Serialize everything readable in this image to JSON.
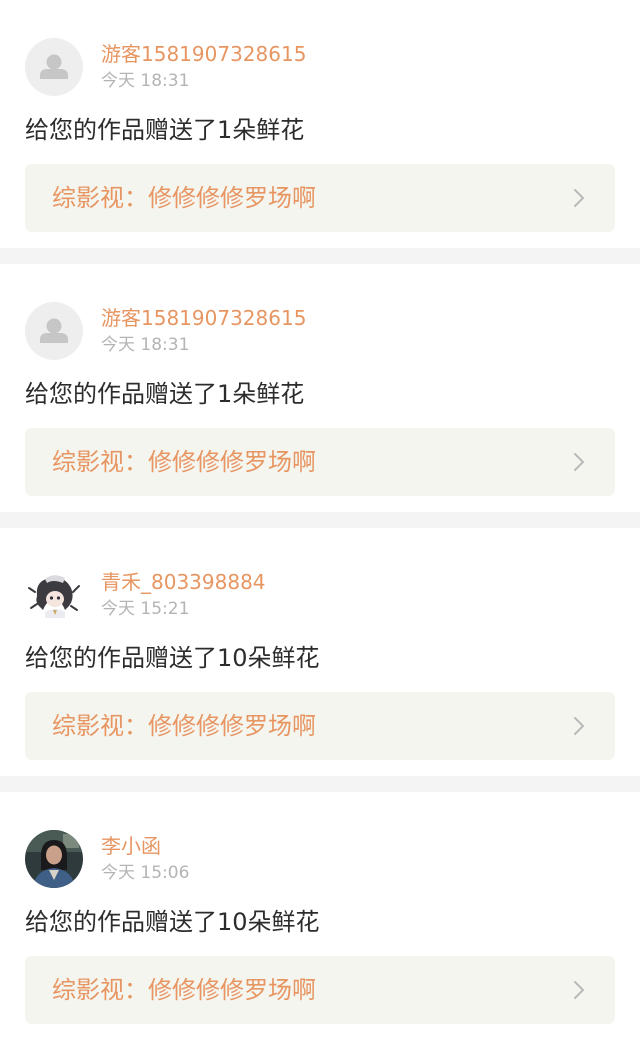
{
  "colors": {
    "accent": "#e79662",
    "tab_indicator": "#e86d9c",
    "card_link_bg": "#f5f5f0",
    "separator": "#f4f4f4"
  },
  "notifications": [
    {
      "avatar": "default-avatar-icon",
      "username": "游客1581907328615",
      "time": "今天 18:31",
      "message": "给您的作品赠送了1朵鲜花",
      "work": "综影视：修修修修罗场啊"
    },
    {
      "avatar": "default-avatar-icon",
      "username": "游客1581907328615",
      "time": "今天 18:31",
      "message": "给您的作品赠送了1朵鲜花",
      "work": "综影视：修修修修罗场啊"
    },
    {
      "avatar": "anime-avatar",
      "username": "青禾_803398884",
      "time": "今天 15:21",
      "message": "给您的作品赠送了10朵鲜花",
      "work": "综影视：修修修修罗场啊"
    },
    {
      "avatar": "photo-avatar",
      "username": "李小函",
      "time": "今天 15:06",
      "message": "给您的作品赠送了10朵鲜花",
      "work": "综影视：修修修修罗场啊"
    }
  ]
}
